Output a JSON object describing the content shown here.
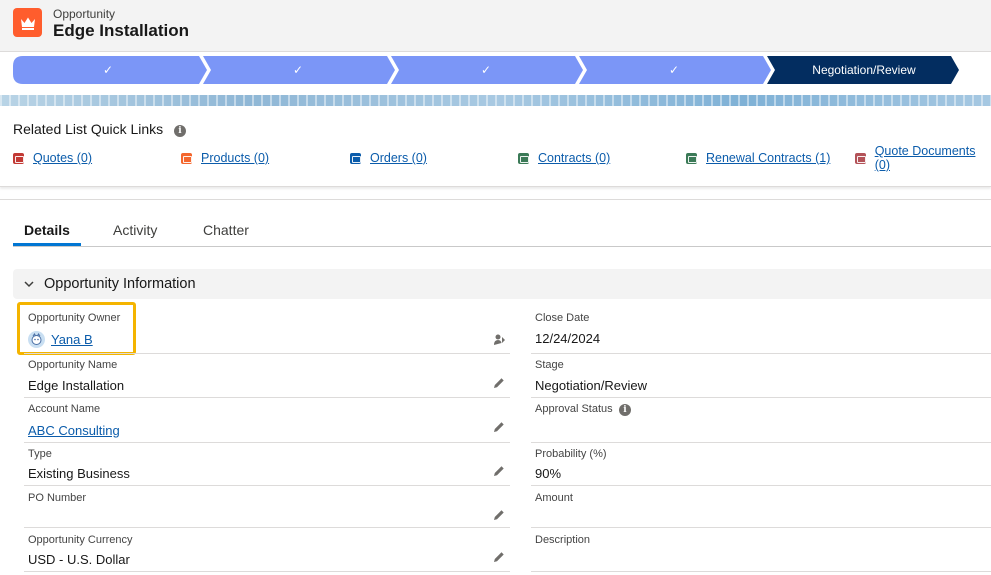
{
  "header": {
    "object_label": "Opportunity",
    "record_title": "Edge Installation",
    "icon": "crown-icon",
    "icon_color": "#ff5d2d"
  },
  "path": {
    "steps": [
      {
        "label": "✓",
        "state": "complete"
      },
      {
        "label": "✓",
        "state": "complete"
      },
      {
        "label": "✓",
        "state": "complete"
      },
      {
        "label": "✓",
        "state": "complete"
      },
      {
        "label": "Negotiation/Review",
        "state": "current"
      }
    ],
    "complete_color": "#7b96f7",
    "current_color": "#032d60"
  },
  "related_quick_links": {
    "title": "Related List Quick Links",
    "links": [
      {
        "label": "Quotes (0)",
        "icon": "quotes-icon",
        "color": "#c23934"
      },
      {
        "label": "Products (0)",
        "icon": "products-icon",
        "color": "#f4662d"
      },
      {
        "label": "Orders (0)",
        "icon": "orders-icon",
        "color": "#0b5cab"
      },
      {
        "label": "Contracts (0)",
        "icon": "contracts-icon",
        "color": "#3b7a57"
      },
      {
        "label": "Renewal Contracts (1)",
        "icon": "renewal-contracts-icon",
        "color": "#3b7a57"
      },
      {
        "label": "Quote Documents (0)",
        "icon": "quote-documents-icon",
        "color": "#b35258"
      }
    ]
  },
  "tabs": [
    {
      "label": "Details",
      "active": true
    },
    {
      "label": "Activity",
      "active": false
    },
    {
      "label": "Chatter",
      "active": false
    }
  ],
  "section": {
    "title": "Opportunity Information"
  },
  "fields": {
    "opportunity_owner": {
      "label": "Opportunity Owner",
      "value": "Yana B"
    },
    "opportunity_name": {
      "label": "Opportunity Name",
      "value": "Edge Installation"
    },
    "account_name": {
      "label": "Account Name",
      "value": "ABC Consulting"
    },
    "type": {
      "label": "Type",
      "value": "Existing Business"
    },
    "po_number": {
      "label": "PO Number",
      "value": ""
    },
    "opportunity_currency": {
      "label": "Opportunity Currency",
      "value": "USD - U.S. Dollar"
    },
    "close_date": {
      "label": "Close Date",
      "value": "12/24/2024"
    },
    "stage": {
      "label": "Stage",
      "value": "Negotiation/Review"
    },
    "approval_status": {
      "label": "Approval Status",
      "value": ""
    },
    "probability": {
      "label": "Probability (%)",
      "value": "90%"
    },
    "amount": {
      "label": "Amount",
      "value": ""
    },
    "description": {
      "label": "Description",
      "value": ""
    }
  }
}
